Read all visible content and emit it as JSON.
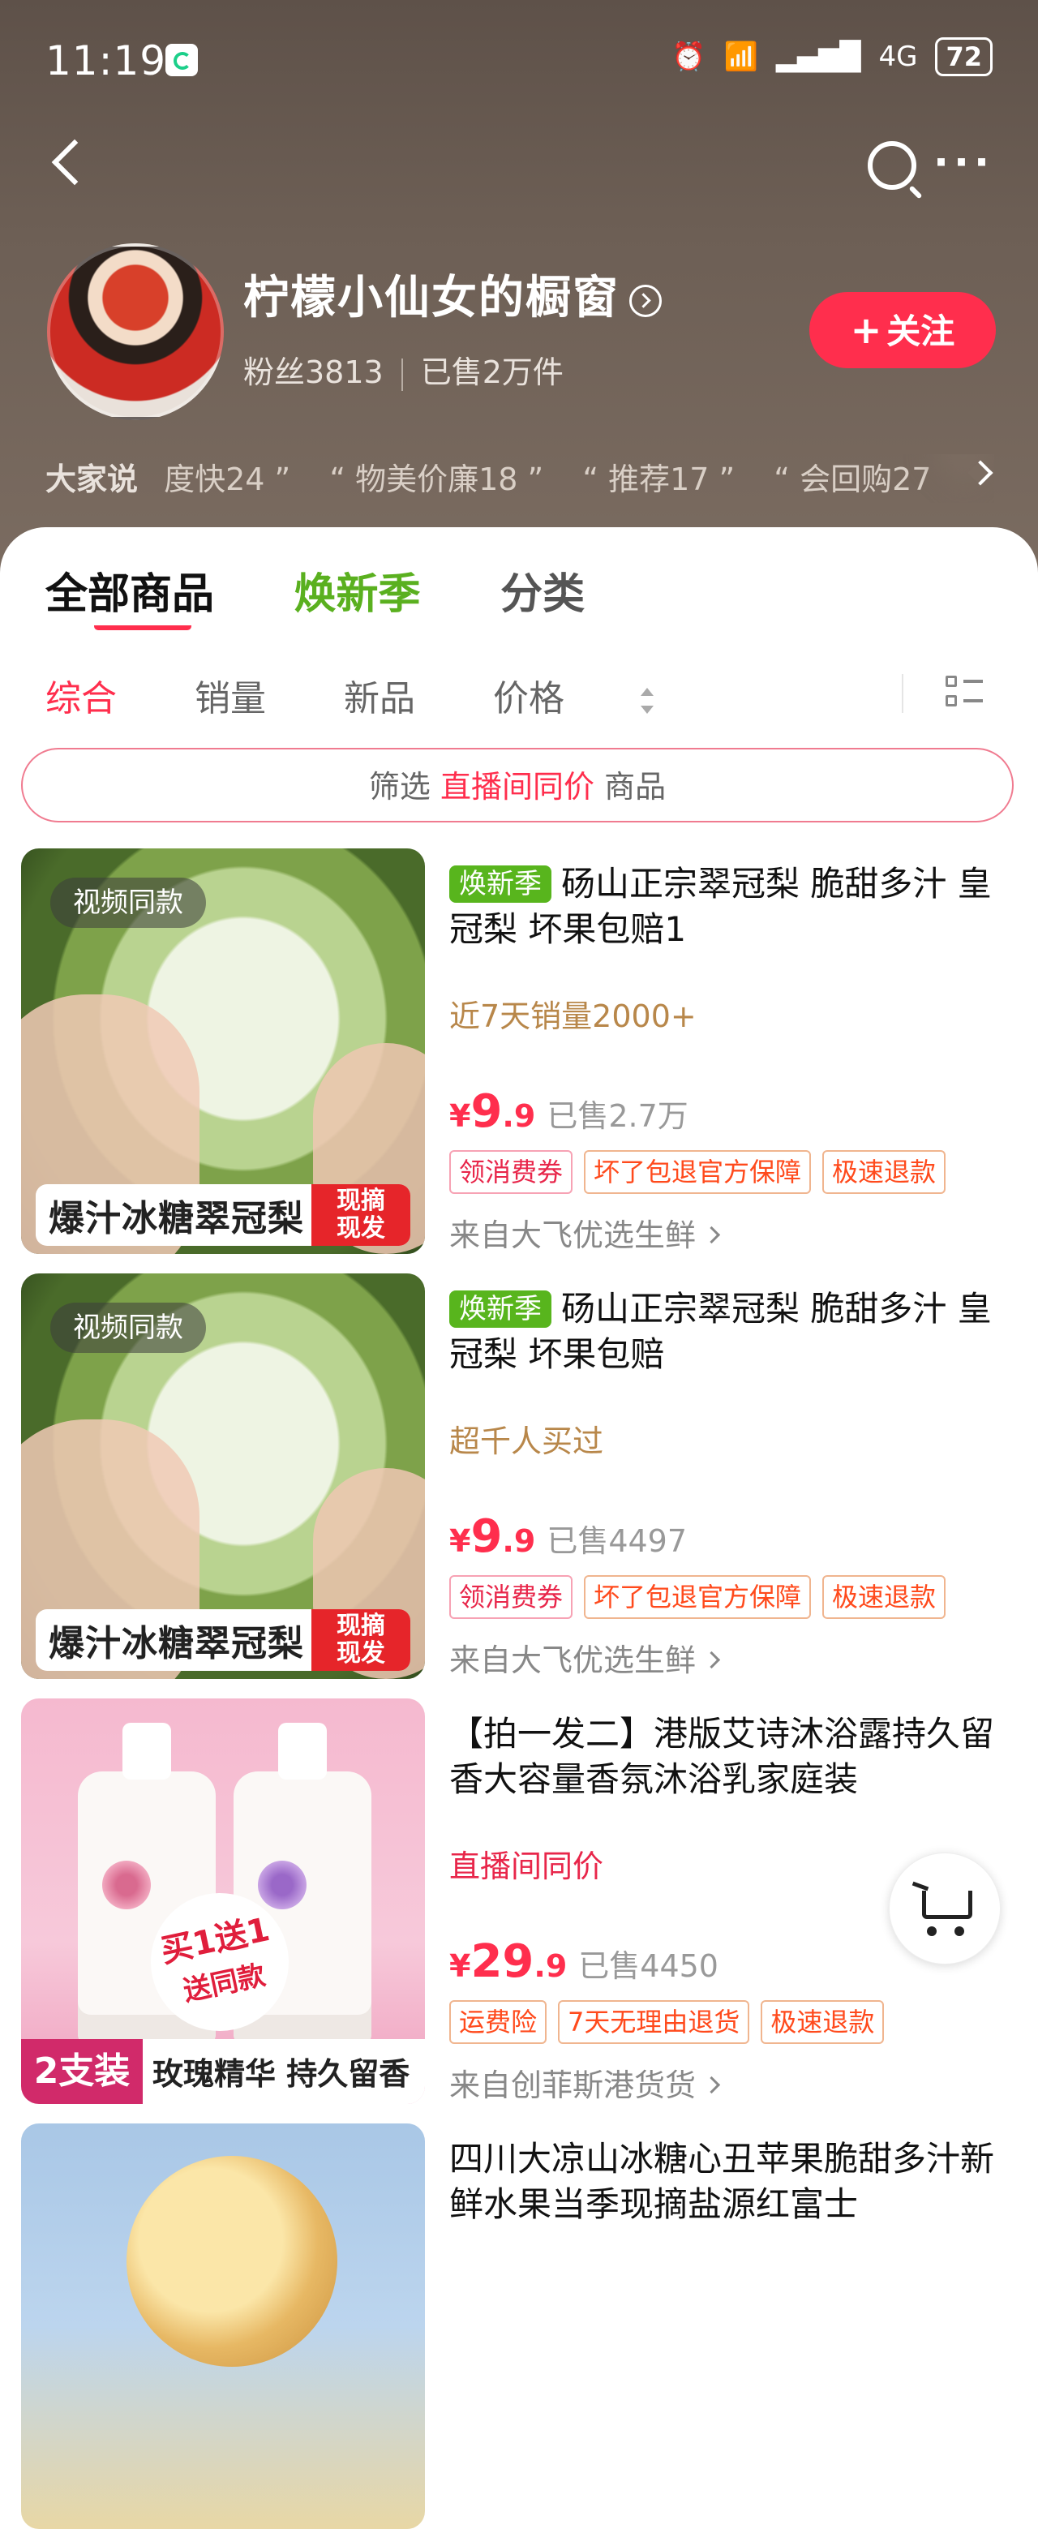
{
  "status_bar": {
    "time": "11:19",
    "battery": "72",
    "network": "4G"
  },
  "shop": {
    "name": "柠檬小仙女的橱窗",
    "fans": "粉丝3813",
    "sold": "已售2万件",
    "follow_label": "关注"
  },
  "reviews": {
    "lead": "大家说",
    "items": [
      "度快24 ”",
      "“ 物美价廉18 ”",
      "“ 推荐17 ”",
      "“ 会回购27"
    ]
  },
  "tabs": [
    "全部商品",
    "焕新季",
    "分类"
  ],
  "sorts": [
    "综合",
    "销量",
    "新品",
    "价格"
  ],
  "filter": {
    "prefix": "筛选",
    "highlight": "直播间同价",
    "suffix": "商品"
  },
  "products": [
    {
      "video_tag": "视频同款",
      "badge": "焕新季",
      "title": "砀山正宗翠冠梨 脆甜多汁 皇冠梨 坏果包赔1",
      "sub": "近7天销量2000+",
      "price_int": "9",
      "price_dec": ".9",
      "sold": "已售2.7万",
      "chips": [
        "领消费券",
        "坏了包退官方保障",
        "极速退款"
      ],
      "source": "来自大飞优选生鲜",
      "img_banner": "爆汁冰糖翠冠梨",
      "img_banner_tag": [
        "现摘",
        "现发"
      ]
    },
    {
      "video_tag": "视频同款",
      "badge": "焕新季",
      "title": "砀山正宗翠冠梨 脆甜多汁 皇冠梨 坏果包赔",
      "sub": "超千人买过",
      "price_int": "9",
      "price_dec": ".9",
      "sold": "已售4497",
      "chips": [
        "领消费券",
        "坏了包退官方保障",
        "极速退款"
      ],
      "source": "来自大飞优选生鲜",
      "img_banner": "爆汁冰糖翠冠梨",
      "img_banner_tag": [
        "现摘",
        "现发"
      ]
    },
    {
      "title": "【拍一发二】港版艾诗沐浴露持久留香大容量香氛沐浴乳家庭装",
      "sub": "直播间同价",
      "price_int": "29",
      "price_dec": ".9",
      "sold": "已售4450",
      "chips": [
        "运费险",
        "7天无理由退货",
        "极速退款"
      ],
      "source": "来自创菲斯港货货",
      "img_promo": [
        "买1送1",
        "送同款"
      ],
      "img_left": "2支装",
      "img_banner": "玫瑰精华 持久留香"
    },
    {
      "title": "四川大凉山冰糖心丑苹果脆甜多汁新鲜水果当季现摘盐源红富士"
    }
  ]
}
